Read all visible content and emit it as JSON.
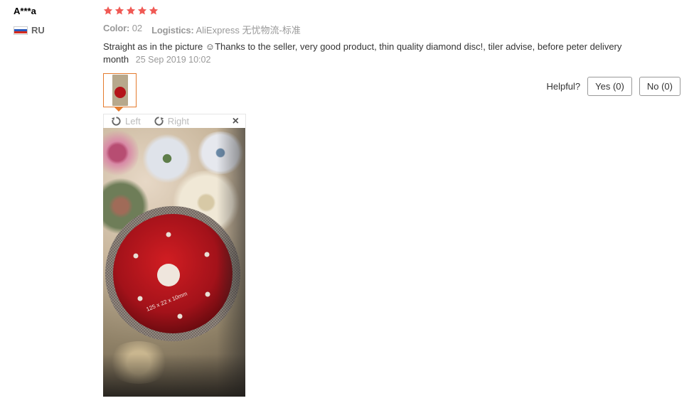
{
  "user": {
    "name": "A***a",
    "country": "RU"
  },
  "rating": {
    "stars": 5,
    "max": 5
  },
  "meta": {
    "color_label": "Color:",
    "color_value": "02",
    "logistics_label": "Logistics:",
    "logistics_value": "AliExpress 无忧物流-标准"
  },
  "review": {
    "text": "Straight as in the picture ☺Thanks to the seller, very good product, thin quality diamond disc!, tiler advise, before peter delivery month",
    "date": "25 Sep 2019 10:02"
  },
  "viewer": {
    "rotate_left": "Left",
    "rotate_right": "Right",
    "close": "×"
  },
  "photo": {
    "disc_text": "125 x 22 x 10mm"
  },
  "helpful": {
    "label": "Helpful?",
    "yes": "Yes (0)",
    "no": "No (0)"
  },
  "colors": {
    "star": "#f05a55",
    "thumb_border": "#e47b2e",
    "disc": "#b4141a"
  }
}
